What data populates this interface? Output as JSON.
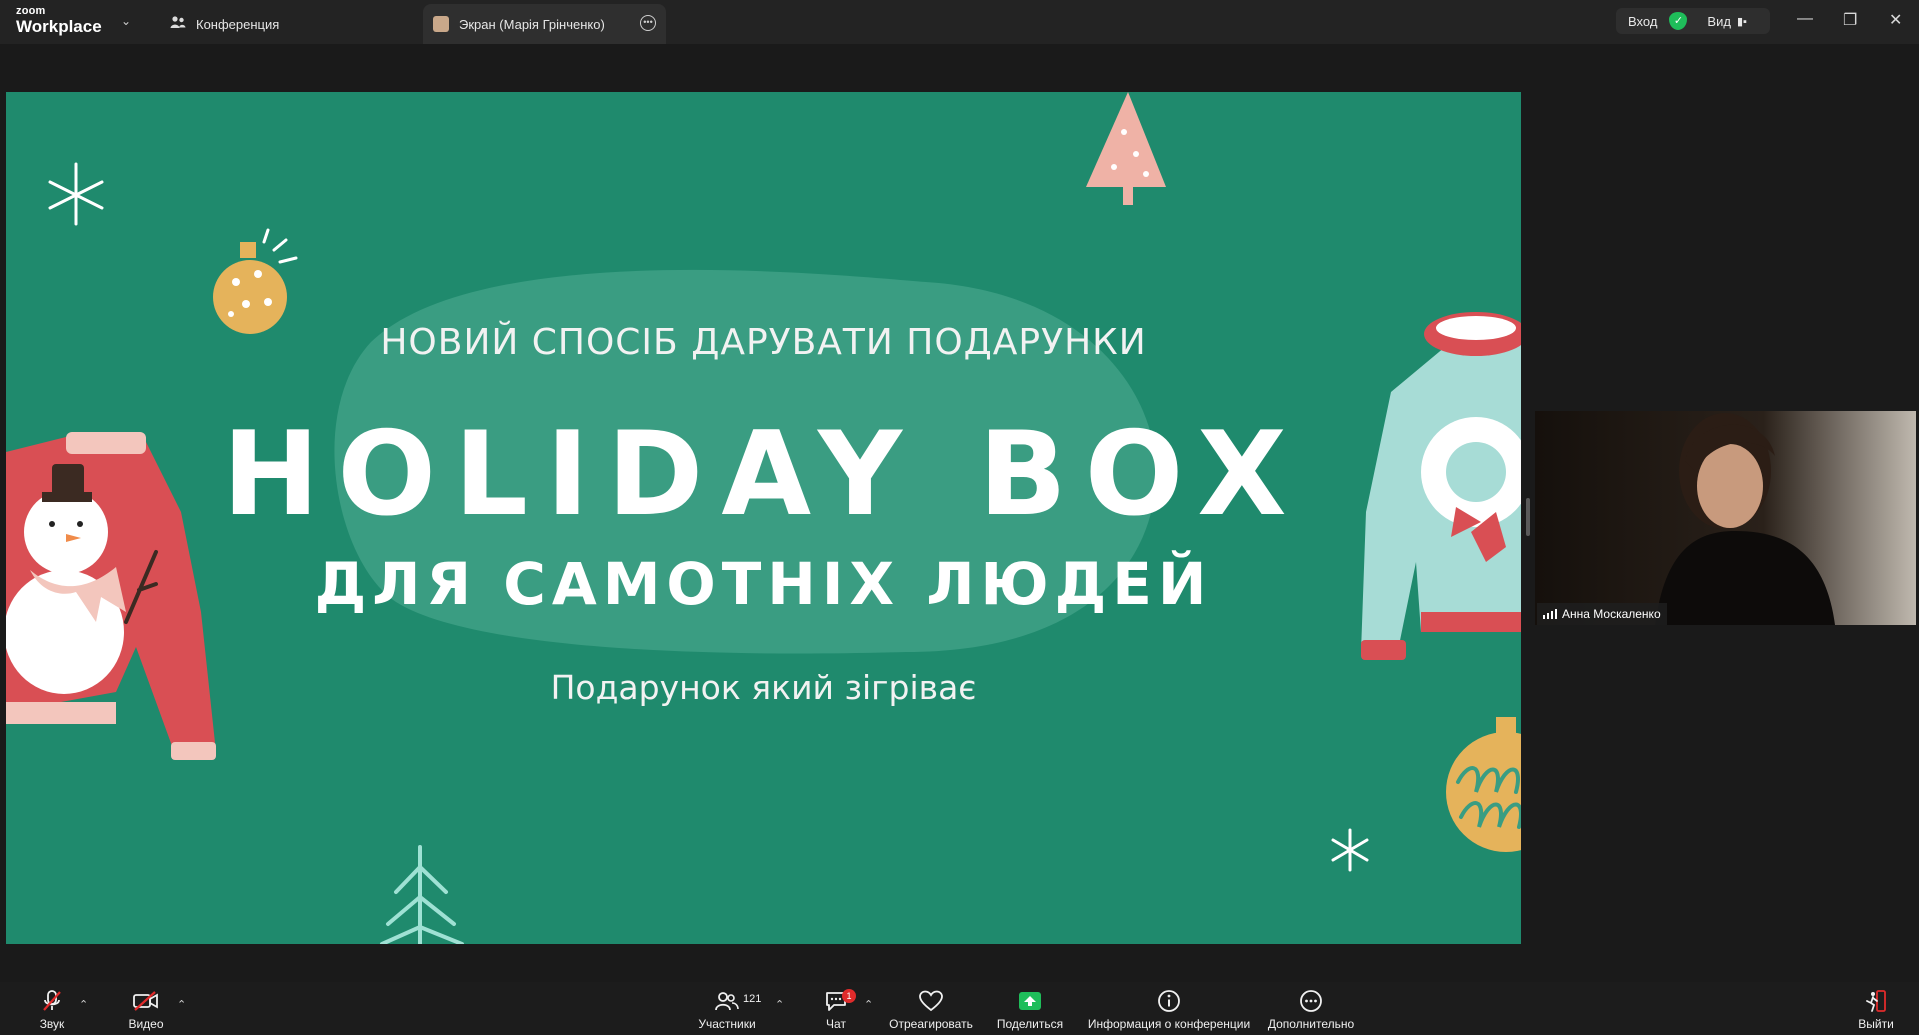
{
  "app": {
    "logo_small": "zoom",
    "logo_large": "Workplace"
  },
  "tabs": [
    {
      "label": "Конференция"
    },
    {
      "label": "Экран (Марія Грінченко)"
    }
  ],
  "status": {
    "login_label": "Вход",
    "view_label": "Вид"
  },
  "slide": {
    "subtitle": "НОВИЙ СПОСІБ ДАРУВАТИ ПОДАРУНКИ",
    "title": "HOLIDAY BOX",
    "title_line2": "ДЛЯ САМОТНІХ ЛЮДЕЙ",
    "tagline": "Подарунок який зігріває",
    "background_color": "#1f8a6d"
  },
  "participant": {
    "name": "Анна Москаленко"
  },
  "toolbar": {
    "audio": "Звук",
    "video": "Видео",
    "participants": "Участники",
    "participants_count": "121",
    "chat": "Чат",
    "chat_badge": "1",
    "react": "Отреагировать",
    "share": "Поделиться",
    "info": "Информация о конференции",
    "more": "Дополнительно",
    "leave": "Выйти"
  },
  "colors": {
    "share_green": "#1fbd5a",
    "alert_red": "#e02b2b",
    "toolbar_bg": "#1c1c1c"
  }
}
